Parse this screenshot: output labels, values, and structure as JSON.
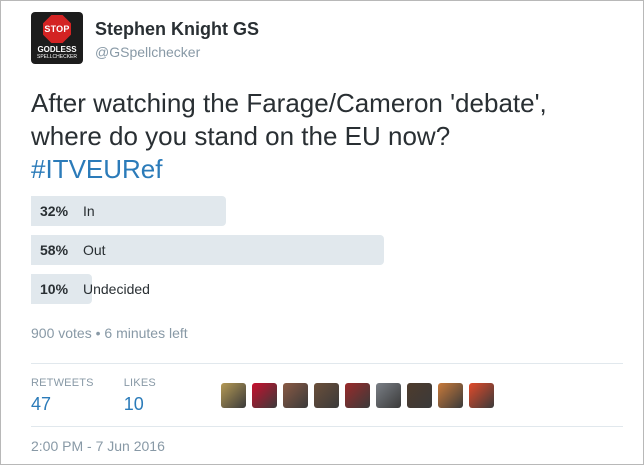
{
  "author": {
    "display_name": "Stephen Knight GS",
    "handle": "@GSpellchecker",
    "avatar_text": {
      "sign": "STOP",
      "line1": "GODLESS",
      "line2": "SPELLCHECKER"
    }
  },
  "tweet": {
    "line1": "After watching the Farage/Cameron 'debate',",
    "line2": "where do you stand on the EU now?",
    "hashtag": "#ITVEURef"
  },
  "poll": {
    "options": [
      {
        "percent": "32%",
        "label": "In",
        "fraction": 0.32
      },
      {
        "percent": "58%",
        "label": "Out",
        "fraction": 0.58
      },
      {
        "percent": "10%",
        "label": "Undecided",
        "fraction": 0.1
      }
    ],
    "meta": "900 votes • 6 minutes left"
  },
  "stats": {
    "retweets_label": "RETWEETS",
    "retweets_value": "47",
    "likes_label": "LIKES",
    "likes_value": "10"
  },
  "likers": [
    {
      "icon": "liker-avatar-1",
      "color": "#b59a55"
    },
    {
      "icon": "liker-avatar-2",
      "color": "#c8102e"
    },
    {
      "icon": "liker-avatar-3",
      "color": "#8a5a44"
    },
    {
      "icon": "liker-avatar-4",
      "color": "#6b4f3a"
    },
    {
      "icon": "liker-avatar-5",
      "color": "#9a2a2a"
    },
    {
      "icon": "liker-avatar-6",
      "color": "#7a7f86"
    },
    {
      "icon": "liker-avatar-7",
      "color": "#4e3b2c"
    },
    {
      "icon": "liker-avatar-8",
      "color": "#c97a3a"
    },
    {
      "icon": "liker-avatar-9",
      "color": "#e24a2a"
    }
  ],
  "timestamp": "2:00 PM - 7 Jun 2016",
  "colors": {
    "link": "#2b7bb9",
    "muted": "#8899a6",
    "poll_bar": "#e1e8ed",
    "text": "#292f33"
  }
}
